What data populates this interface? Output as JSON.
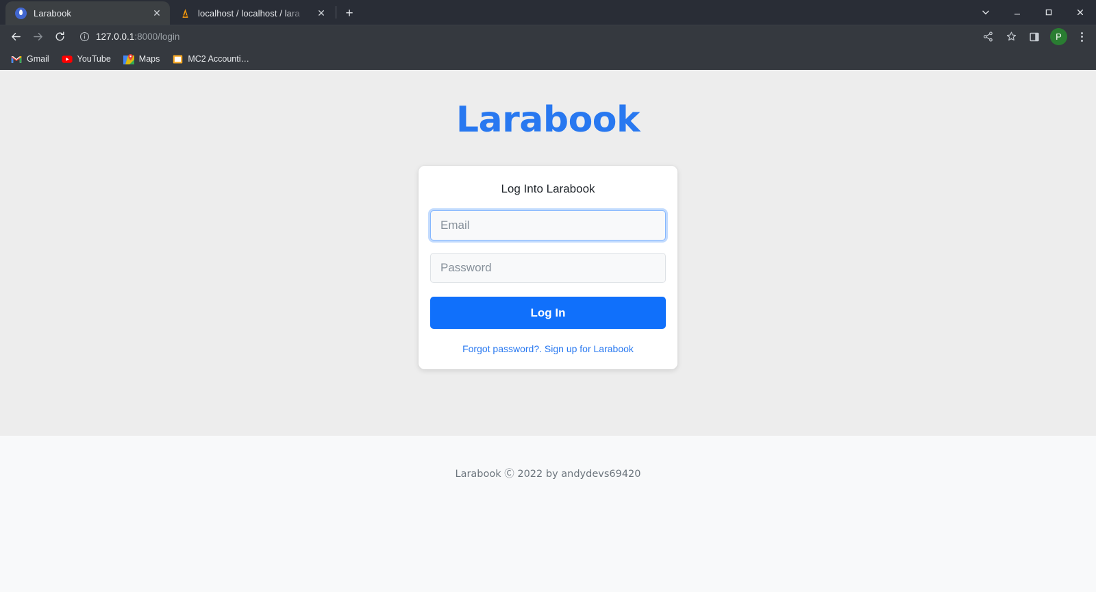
{
  "browser": {
    "tabs": [
      {
        "title": "Larabook",
        "favicon": "larabook-balloon-icon",
        "active": true,
        "close_label": "✕"
      },
      {
        "title": "localhost / localhost / lara",
        "favicon": "phpmyadmin-icon",
        "active": false,
        "close_label": "✕"
      }
    ],
    "new_tab_label": "+",
    "window_controls": {
      "chevron_label": "chevron-down",
      "minimize_label": "minimize",
      "maximize_label": "maximize",
      "close_label": "close"
    },
    "toolbar": {
      "back_label": "back",
      "forward_label": "forward",
      "reload_label": "reload",
      "site_info_label": "site-information",
      "url_host": "127.0.0.1",
      "url_rest": ":8000/login",
      "share_label": "share",
      "bookmark_label": "bookmark-star",
      "side_panel_label": "side-panel",
      "profile_initial": "P",
      "menu_label": "chrome-menu"
    },
    "bookmarks": [
      {
        "label": "Gmail",
        "icon": "gmail-icon"
      },
      {
        "label": "YouTube",
        "icon": "youtube-icon"
      },
      {
        "label": "Maps",
        "icon": "google-maps-icon"
      },
      {
        "label": "MC2 Accounti…",
        "icon": "folder-icon"
      }
    ]
  },
  "page": {
    "brand": "Larabook",
    "card": {
      "title": "Log Into Larabook",
      "email": {
        "value": "",
        "placeholder": "Email"
      },
      "password": {
        "value": "",
        "placeholder": "Password"
      },
      "submit_label": "Log In",
      "forgot_label": "Forgot password?",
      "separator": ".",
      "signup_label": "Sign up for Larabook"
    },
    "footer_text": "Larabook Ⓒ 2022 by andydevs69420"
  },
  "colors": {
    "brand_blue": "#2878f0",
    "button_blue": "#1070fb",
    "page_bg": "#ededed",
    "footer_bg": "#f8f9fa",
    "chrome_bg": "#35393f",
    "avatar_green": "#2a7d32"
  }
}
